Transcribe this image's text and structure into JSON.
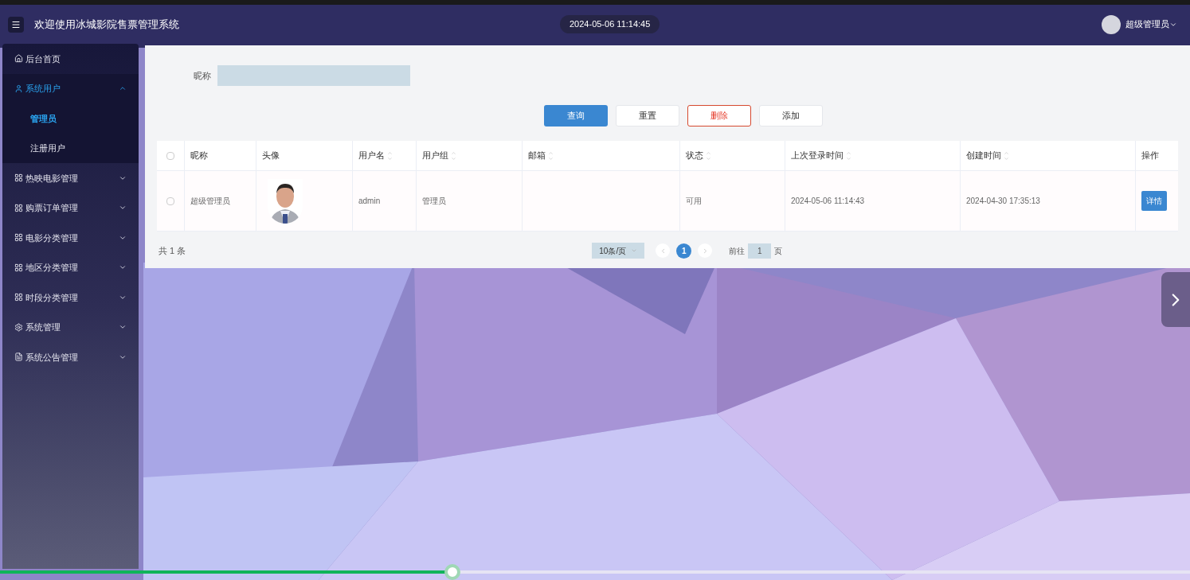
{
  "header": {
    "title": "欢迎使用冰城影院售票管理系统",
    "datetime": "2024-05-06 11:14:45",
    "user": "超级管理员"
  },
  "sidebar": {
    "items": [
      {
        "label": "后台首页",
        "kind": "home",
        "selected": false
      },
      {
        "label": "系统用户",
        "kind": "user",
        "selected": true,
        "expanded": true,
        "children": [
          {
            "label": "管理员",
            "selected": true
          },
          {
            "label": "注册用户",
            "selected": false
          }
        ]
      },
      {
        "label": "热映电影管理",
        "kind": "grid",
        "selected": false,
        "expanded": false
      },
      {
        "label": "购票订单管理",
        "kind": "grid",
        "selected": false,
        "expanded": false
      },
      {
        "label": "电影分类管理",
        "kind": "grid",
        "selected": false,
        "expanded": false
      },
      {
        "label": "地区分类管理",
        "kind": "grid",
        "selected": false,
        "expanded": false
      },
      {
        "label": "时段分类管理",
        "kind": "grid",
        "selected": false,
        "expanded": false
      },
      {
        "label": "系统管理",
        "kind": "gear",
        "selected": false,
        "expanded": false
      },
      {
        "label": "系统公告管理",
        "kind": "doc",
        "selected": false,
        "expanded": false
      }
    ]
  },
  "search": {
    "label": "昵称"
  },
  "buttons": [
    {
      "label": "查询",
      "kind": "primary"
    },
    {
      "label": "重置",
      "kind": "default"
    },
    {
      "label": "删除",
      "kind": "danger"
    },
    {
      "label": "添加",
      "kind": "default"
    }
  ],
  "table": {
    "header_checked": false,
    "columns": [
      {
        "label": "昵称",
        "sortable": false
      },
      {
        "label": "头像",
        "sortable": false
      },
      {
        "label": "用户名",
        "sortable": true
      },
      {
        "label": "用户组",
        "sortable": true
      },
      {
        "label": "邮箱",
        "sortable": true
      },
      {
        "label": "状态",
        "sortable": true
      },
      {
        "label": "上次登录时间",
        "sortable": true
      },
      {
        "label": "创建时间",
        "sortable": true
      },
      {
        "label": "操作",
        "sortable": false
      }
    ],
    "rows": [
      {
        "checked": false,
        "cells": [
          {
            "kind": "text",
            "text": "超级管理员"
          },
          {
            "kind": "picture"
          },
          {
            "kind": "text",
            "text": "admin"
          },
          {
            "kind": "text",
            "text": "管理员"
          },
          {
            "kind": "empty"
          },
          {
            "kind": "text",
            "text": "可用"
          },
          {
            "kind": "text",
            "text": "2024-05-06 11:14:43"
          },
          {
            "kind": "text",
            "text": "2024-04-30 17:35:13"
          },
          {
            "kind": "button",
            "text": "详情"
          }
        ]
      }
    ]
  },
  "pagination": {
    "total": "共 1 条",
    "page_size": "10条/页",
    "pages": [
      {
        "label": "1",
        "selected": true
      }
    ],
    "goto_label": "前往",
    "goto_value": "1",
    "goto_suffix": "页"
  },
  "player": {
    "level": 0.38
  }
}
